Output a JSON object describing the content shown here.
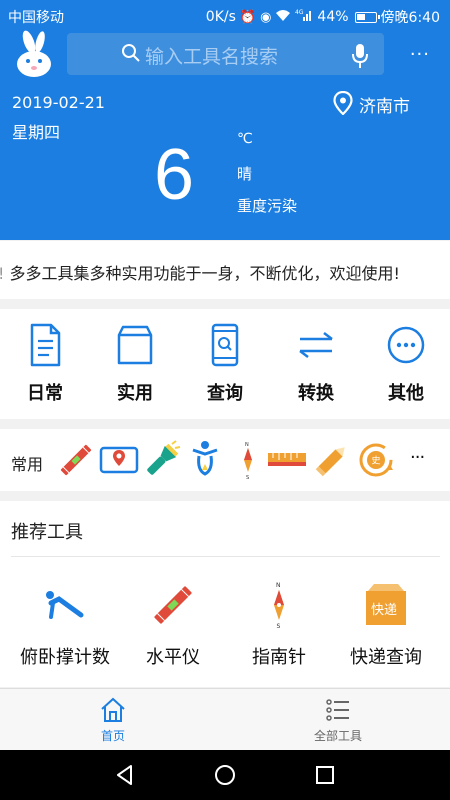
{
  "status_bar": {
    "carrier": "中国移动",
    "speed": "0K/s",
    "battery": "44%",
    "time": "傍晚6:40"
  },
  "search": {
    "placeholder": "输入工具名搜索"
  },
  "weather": {
    "date": "2019-02-21",
    "weekday": "星期四",
    "city": "济南市",
    "temperature": "6",
    "unit": "℃",
    "condition": "晴",
    "air_quality": "重度污染"
  },
  "marquee": {
    "text": "多多工具集多种实用功能于一身，不断优化，欢迎使用!"
  },
  "categories": [
    {
      "label": "日常",
      "icon": "document-icon"
    },
    {
      "label": "实用",
      "icon": "box-icon"
    },
    {
      "label": "查询",
      "icon": "phone-search-icon"
    },
    {
      "label": "转换",
      "icon": "swap-arrows-icon"
    },
    {
      "label": "其他",
      "icon": "more-circle-icon"
    }
  ],
  "frequent": {
    "label": "常用",
    "tools": [
      "level-icon",
      "phone-location-icon",
      "flashlight-icon",
      "body-icon",
      "compass-icon",
      "ruler-icon",
      "pencil-icon",
      "history-icon"
    ],
    "more": "···"
  },
  "recommended": {
    "title": "推荐工具",
    "tools": [
      {
        "label": "俯卧撑计数",
        "icon": "pushup-icon"
      },
      {
        "label": "水平仪",
        "icon": "level-icon"
      },
      {
        "label": "指南针",
        "icon": "compass-needle-icon"
      },
      {
        "label": "快递查询",
        "icon": "package-icon",
        "badge": "快递"
      }
    ]
  },
  "tabs": [
    {
      "label": "首页",
      "icon": "home-icon",
      "active": true
    },
    {
      "label": "全部工具",
      "icon": "list-icon",
      "active": false
    }
  ],
  "colors": {
    "primary": "#1b7ee0",
    "search_bg": "#3f8fdf",
    "orange": "#f0a030",
    "red": "#e04a3a",
    "teal": "#1aa38c"
  }
}
